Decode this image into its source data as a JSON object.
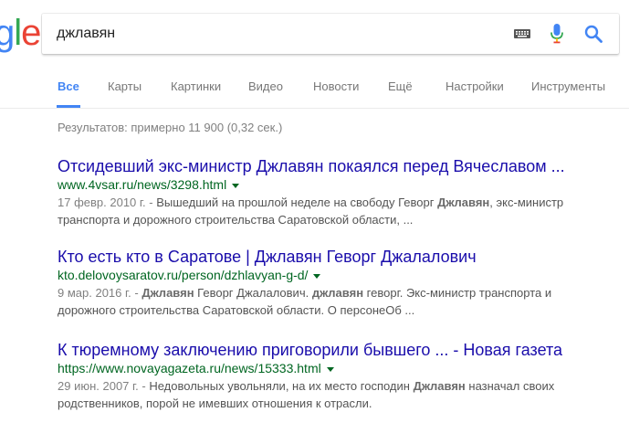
{
  "logo": {
    "parts": [
      "g",
      "l",
      "e"
    ],
    "colors": [
      "#4285f4",
      "#34a853",
      "#ea4335"
    ]
  },
  "search": {
    "query": "джлавян",
    "icons": [
      "keyboard-icon",
      "microphone-icon",
      "search-icon"
    ]
  },
  "tabs": [
    {
      "label": "Все",
      "active": true
    },
    {
      "label": "Карты",
      "active": false
    },
    {
      "label": "Картинки",
      "active": false
    },
    {
      "label": "Видео",
      "active": false
    },
    {
      "label": "Новости",
      "active": false
    },
    {
      "label": "Ещё",
      "active": false
    },
    {
      "label": "Настройки",
      "active": false
    },
    {
      "label": "Инструменты",
      "active": false
    }
  ],
  "stats": "Результатов: примерно 11 900 (0,32 сек.)",
  "results": [
    {
      "title": "Отсидевший экс-министр Джлавян покаялся перед Вячеславом ...",
      "url": "www.4vsar.ru/news/3298.html",
      "date": "17 февр. 2010 г. - ",
      "snippet_pre": "Вышедший на прошлой неделе на свободу Геворг ",
      "snippet_bold": "Джлавян",
      "snippet_post": ", экс-министр транспорта и дорожного строительства Саратовской области, ..."
    },
    {
      "title": "Кто есть кто в Саратове | Джлавян Геворг Джалалович",
      "url": "kto.delovoysaratov.ru/person/dzhlavyan-g-d/",
      "date": "9 мар. 2016 г. - ",
      "snippet_bold1": "Джлавян",
      "snippet_mid": " Геворг Джалалович. ",
      "snippet_bold2": "джлавян",
      "snippet_post": " геворг. Экс-министр транспорта и дорожного строительства Саратовской области. О персонеОб ..."
    },
    {
      "title": "К тюремному заключению приговорили бывшего ... - Новая газета",
      "url": "https://www.novayagazeta.ru/news/15333.html",
      "date": "29 июн. 2007 г. - ",
      "snippet_pre": "Недовольных увольняли, на их место господин ",
      "snippet_bold": "Джлавян",
      "snippet_post": " назначал своих родственников, порой не имевших отношения к отрасли."
    }
  ]
}
